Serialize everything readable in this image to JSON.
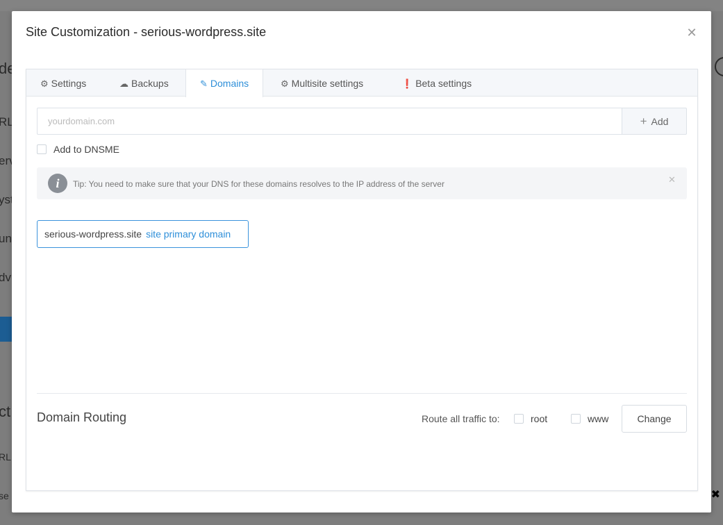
{
  "background": {
    "fragments": [
      "de",
      "RL",
      "erv",
      "yst",
      "un",
      "dv",
      "ct",
      "RL",
      "se"
    ]
  },
  "modal": {
    "title": "Site Customization - serious-wordpress.site",
    "close_icon": "close-icon"
  },
  "tabs": [
    {
      "label": "Settings",
      "icon": "gear-icon"
    },
    {
      "label": "Backups",
      "icon": "cloud-upload-icon"
    },
    {
      "label": "Domains",
      "icon": "edit-icon",
      "active": true
    },
    {
      "label": "Multisite settings",
      "icon": "gear-icon"
    },
    {
      "label": "Beta settings",
      "icon": "alert-circle-icon"
    }
  ],
  "domain_form": {
    "placeholder": "yourdomain.com",
    "value": "",
    "add_label": "Add",
    "dnsme_label": "Add to DNSME",
    "dnsme_checked": false
  },
  "tip": {
    "text": "Tip: You need to make sure that your DNS for these domains resolves to the IP address of the server"
  },
  "domains": [
    {
      "name": "serious-wordpress.site",
      "tag": "site primary domain"
    }
  ],
  "routing": {
    "title": "Domain Routing",
    "route_label": "Route all traffic to:",
    "options": [
      {
        "label": "root",
        "checked": false
      },
      {
        "label": "www",
        "checked": false
      }
    ],
    "change_label": "Change"
  },
  "colors": {
    "accent": "#2e8fd9",
    "overlay": "#7d7d7d"
  }
}
